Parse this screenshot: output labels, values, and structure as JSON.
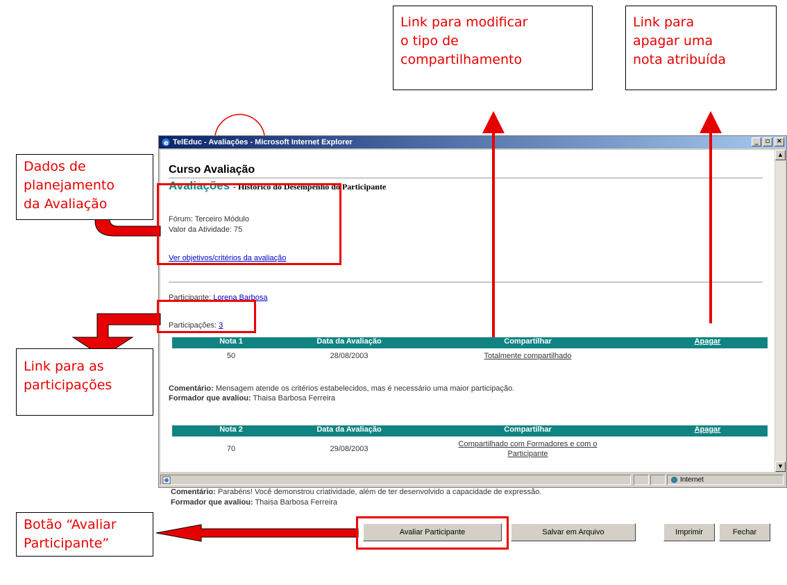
{
  "window": {
    "title": "TelEduc - Avaliações - Microsoft Internet Explorer",
    "controls": [
      "_",
      "▫",
      "×"
    ],
    "status_zone": "Internet"
  },
  "page": {
    "course_title": "Curso Avaliação",
    "section_title": "Avaliações",
    "section_subtitle": "- Histórico do Desempenho do Participante",
    "forum_line": "Fórum: Terceiro Módulo",
    "activity_value_line": "Valor da Atividade: 75",
    "criteria_link": "Ver objetivos/critérios da avaliação",
    "participant_label": "Participante:",
    "participant_name": "Lorena Barbosa",
    "participations_label": "Participações:",
    "participations_count": "3",
    "grades": [
      {
        "headers": [
          "Nota 1",
          "Data da Avaliação",
          "Compartilhar",
          "Apagar"
        ],
        "value": "50",
        "date": "28/08/2003",
        "share_line1": "Totalmente compartilhado",
        "share_line2": "",
        "comment_label": "Comentário:",
        "comment": "Mensagem atende os critérios estabelecidos, mas é necessário uma maior participação.",
        "evaluator_label": "Formador que avaliou:",
        "evaluator": "Thaisa Barbosa Ferreira"
      },
      {
        "headers": [
          "Nota 2",
          "Data da Avaliação",
          "Compartilhar",
          "Apagar"
        ],
        "value": "70",
        "date": "29/08/2003",
        "share_line1": "Compartilhado com Formadores e com o",
        "share_line2": "Participante",
        "comment_label": "Comentário:",
        "comment": "Parabéns! Você demonstrou criatividade, além de ter desenvolvido a capacidade de expressão.",
        "evaluator_label": "Formador que avaliou:",
        "evaluator": "Thaisa Barbosa Ferreira"
      }
    ],
    "buttons": {
      "evaluate": "Avaliar Participante",
      "save": "Salvar em Arquivo",
      "print": "Imprimir",
      "close": "Fechar"
    }
  },
  "annotations": {
    "planning": [
      "Dados de",
      "planejamento",
      "da Avaliação"
    ],
    "participations": [
      "Link para as",
      "participações"
    ],
    "evaluate_button": [
      "Botão “Avaliar",
      "Participante”"
    ],
    "sharing": [
      "Link para modificar",
      "o tipo de",
      "compartilhamento"
    ],
    "delete": [
      "Link para",
      "apagar uma",
      "nota atribuída"
    ],
    "color": "#e60000"
  }
}
